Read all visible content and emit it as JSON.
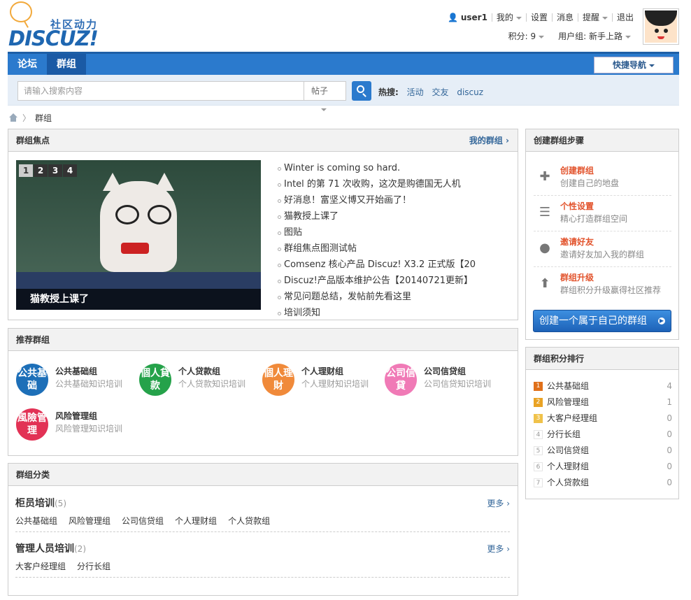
{
  "logo": {
    "cn": "社区动力",
    "en": "DISCUZ!"
  },
  "user": {
    "name": "user1",
    "menu": [
      "我的",
      "设置",
      "消息",
      "提醒",
      "退出"
    ],
    "points": "积分: 9",
    "group": "用户组: 新手上路"
  },
  "nav": {
    "tabs": [
      "论坛",
      "群组"
    ],
    "quick": "快捷导航"
  },
  "search": {
    "placeholder": "请输入搜索内容",
    "type": "帖子",
    "hot_label": "热搜:",
    "hot": [
      "活动",
      "交友",
      "discuz"
    ]
  },
  "breadcrumb": {
    "current": "群组"
  },
  "focus": {
    "title": "群组焦点",
    "my_groups": "我的群组",
    "pages": [
      "1",
      "2",
      "3",
      "4"
    ],
    "caption": "猫教授上课了",
    "items": [
      "Winter is coming so hard.",
      "Intel 的第 71 次收购，这次是购德国无人机",
      "好消息！富坚义博又开始画了！",
      "猫教授上课了",
      "图贴",
      "群组焦点图测试帖",
      "Comsenz 核心产品 Discuz! X3.2 正式版【20",
      "Discuz!产品版本维护公告【20140721更新】",
      "常见问题总结，发帖前先看这里",
      "培训须知"
    ]
  },
  "recommend": {
    "title": "推荐群组",
    "groups": [
      {
        "name": "公共基础组",
        "desc": "公共基础知识培训",
        "icon": "公共基础",
        "color": "#1d6fb8"
      },
      {
        "name": "个人贷款组",
        "desc": "个人贷款知识培训",
        "icon": "個人貸款",
        "color": "#25a24a"
      },
      {
        "name": "个人理财组",
        "desc": "个人理财知识培训",
        "icon": "個人理財",
        "color": "#f08a3a"
      },
      {
        "name": "公司信贷组",
        "desc": "公司信贷知识培训",
        "icon": "公司信貸",
        "color": "#f07ab6"
      },
      {
        "name": "风险管理组",
        "desc": "风险管理知识培训",
        "icon": "風險管理",
        "color": "#e23255"
      }
    ]
  },
  "categories": {
    "title": "群组分类",
    "more": "更多",
    "sections": [
      {
        "name": "柜员培训",
        "count": "(5)",
        "links": [
          "公共基础组",
          "风险管理组",
          "公司信贷组",
          "个人理财组",
          "个人贷款组"
        ]
      },
      {
        "name": "管理人员培训",
        "count": "(2)",
        "links": [
          "大客户经理组",
          "分行长组"
        ]
      }
    ]
  },
  "steps": {
    "title": "创建群组步骤",
    "items": [
      {
        "title": "创建群组",
        "desc": "创建自己的地盘",
        "icon": "plus-icon"
      },
      {
        "title": "个性设置",
        "desc": "精心打造群组空间",
        "icon": "list-icon"
      },
      {
        "title": "邀请好友",
        "desc": "邀请好友加入我的群组",
        "icon": "user-icon"
      },
      {
        "title": "群组升级",
        "desc": "群组积分升级赢得社区推荐",
        "icon": "arrow-up-icon"
      }
    ],
    "button": "创建一个属于自己的群组"
  },
  "ranking": {
    "title": "群组积分排行",
    "items": [
      {
        "rank": "1",
        "name": "公共基础组",
        "score": "4"
      },
      {
        "rank": "2",
        "name": "风险管理组",
        "score": "1"
      },
      {
        "rank": "3",
        "name": "大客户经理组",
        "score": "0"
      },
      {
        "rank": "4",
        "name": "分行长组",
        "score": "0"
      },
      {
        "rank": "5",
        "name": "公司信贷组",
        "score": "0"
      },
      {
        "rank": "6",
        "name": "个人理财组",
        "score": "0"
      },
      {
        "rank": "7",
        "name": "个人贷款组",
        "score": "0"
      }
    ],
    "rank_colors": [
      "#e0701a",
      "#e9a325",
      "#f0c24a"
    ]
  }
}
